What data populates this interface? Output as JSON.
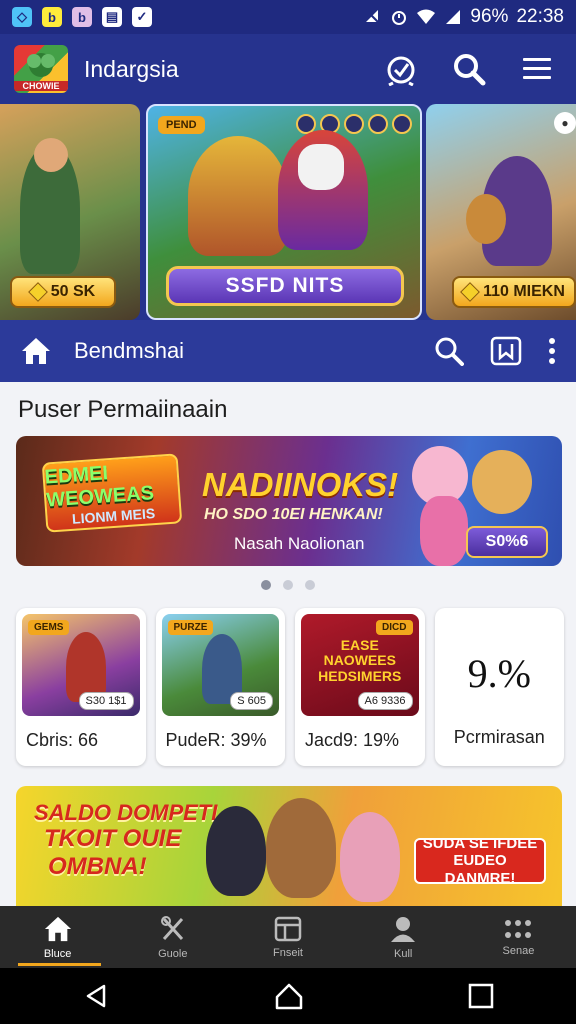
{
  "status_bar": {
    "app_icons": [
      {
        "name": "phone-app-icon",
        "glyph": "☉",
        "color": "#4fc3f7"
      },
      {
        "name": "b-app-icon",
        "glyph": "b",
        "color": "#ffeb3b"
      },
      {
        "name": "b-app-icon-2",
        "glyph": "b",
        "color": "#e1bee7"
      },
      {
        "name": "save-app-icon",
        "glyph": "▤",
        "color": "#ffffff"
      },
      {
        "name": "checkbox-app-icon",
        "glyph": "✓",
        "color": "#ffffff"
      }
    ],
    "battery": "96%",
    "time": "22:38"
  },
  "app_bar": {
    "logo_text": "CHOWIE",
    "title": "Indargsia"
  },
  "carousel": {
    "slides": [
      {
        "badge": "50 SK"
      },
      {
        "tag": "PEND",
        "cta": "SSFD NITS"
      },
      {
        "badge": "110 MIEKN"
      }
    ]
  },
  "sub_bar": {
    "title": "Bendmshai"
  },
  "section": {
    "title": "Puser Permaiinaain"
  },
  "promo": {
    "logo_line1": "EDMEI WEOWEAS",
    "logo_line2": "LIONM MEIS",
    "headline": "NADIINOKS!",
    "subline": "HO SDO 10EI HENKAN!",
    "note": "Nasah Naolionan",
    "button": "S0%6"
  },
  "carousel_dots": {
    "count": 3,
    "active": 0
  },
  "cards": [
    {
      "label": "Cbris: 66",
      "tag": "GEMS",
      "price": "S30 1$1"
    },
    {
      "label": "PudeR: 39%",
      "tag": "PURZE",
      "price": "S 605"
    },
    {
      "label": "Jacd9: 19%",
      "tag": "DICD",
      "price": "A6 9336",
      "art_text": "EASE NAOWEES HEDSIMERS"
    }
  ],
  "stat_card": {
    "value": "9.%",
    "label": "Pcrmirasan"
  },
  "banner2": {
    "line1": "SALDO DOMPETI",
    "line2": "TKOIT OUIE",
    "line3": "OMBNA!",
    "button_line1": "SUDA SE IFDEE",
    "button_line2": "EUDEO DANMRE!"
  },
  "bottom_nav": [
    {
      "label": "Bluce",
      "icon": "home-icon",
      "active": true
    },
    {
      "label": "Guole",
      "icon": "tools-icon",
      "active": false
    },
    {
      "label": "Fnseit",
      "icon": "layout-icon",
      "active": false
    },
    {
      "label": "Kull",
      "icon": "person-icon",
      "active": false
    },
    {
      "label": "Senae",
      "icon": "grid-icon",
      "active": false
    }
  ],
  "colors": {
    "primary": "#26338e",
    "status_bar": "#1f2a80",
    "accent": "#f2a71d"
  }
}
